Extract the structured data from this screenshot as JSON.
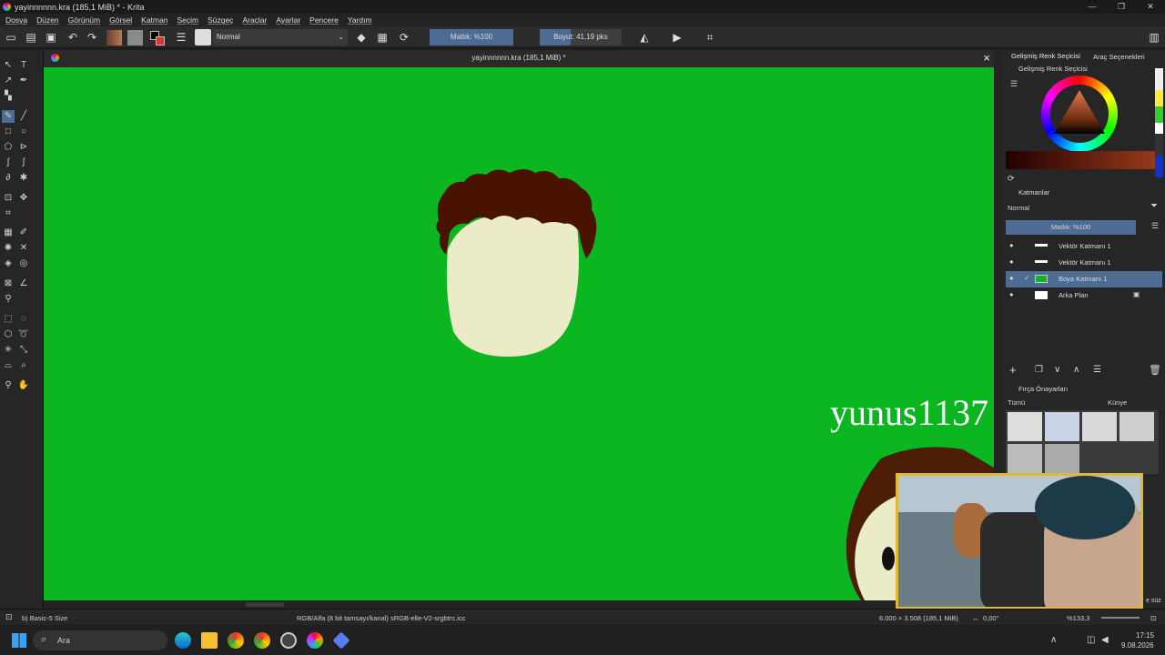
{
  "window": {
    "title": "yayinnnnnn.kra (185,1 MiB) * - Krita",
    "controls": [
      "—",
      "❐",
      "✕"
    ]
  },
  "menu": [
    "Dosya",
    "Düzen",
    "Görünüm",
    "Görsel",
    "Katman",
    "Seçim",
    "Süzgeç",
    "Araçlar",
    "Ayarlar",
    "Pencere",
    "Yardım"
  ],
  "toolbar": {
    "blend_mode": "Normal",
    "opacity": "Matlık: %100",
    "size": "Boyut: 41,19 pks"
  },
  "document": {
    "tab_name": "yayinnnnnn.kra (185,1 MiB) *"
  },
  "canvas": {
    "background_color": "#0cb620",
    "overlay_text": "yunus1137"
  },
  "dock": {
    "tabs": [
      "Gelişmiş Renk Seçicisi",
      "Araç Seçenekleri"
    ],
    "color_panel_title": "Gelişmiş Renk Seçicisi",
    "layers_title": "Katmanlar",
    "layers_blend": "Normal",
    "layers_opacity": "Matlık: %100",
    "layers": [
      {
        "name": "Vektör Katmanı 1",
        "selected": false
      },
      {
        "name": "Vektör Katmanı 1",
        "selected": false
      },
      {
        "name": "Boya Katmanı 1",
        "selected": true
      },
      {
        "name": "Arka Plan",
        "selected": false
      }
    ],
    "brush_presets_title": "Fırça Önayarları",
    "brush_filter": "Tümü",
    "brush_tag": "Künye",
    "brush_search_hint": "e süz"
  },
  "status": {
    "brush": "b) Basic-5 Size",
    "color_profile": "RGB/Alfa (8 bit tamsayı/kanal) sRGB-elle-V2-srgbtrc.icc",
    "image_size": "6.000 × 3.508 (185,1 MiB)",
    "rotation": "0,00°",
    "zoom": "%133,3"
  },
  "taskbar": {
    "search_placeholder": "Ara",
    "time": "17:15",
    "date": "9.08.2026"
  }
}
